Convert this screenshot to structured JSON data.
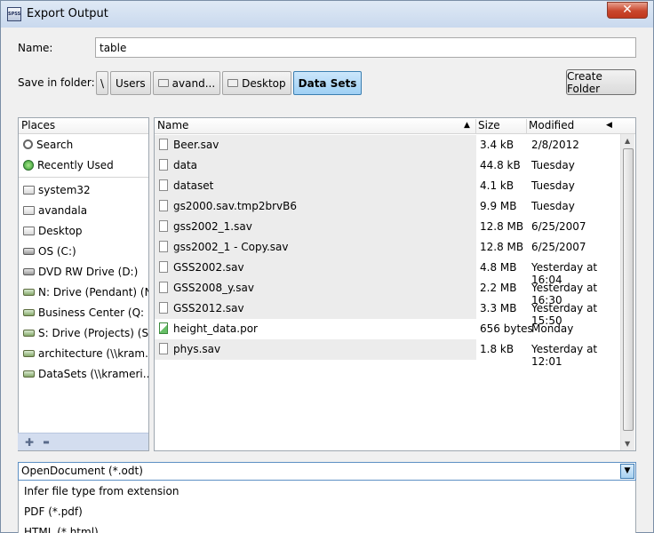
{
  "window": {
    "title": "Export Output",
    "app_icon_text": "SPSS",
    "close_icon": "close-icon"
  },
  "name_field": {
    "label": "Name:",
    "value": "table"
  },
  "folder": {
    "label": "Save in folder:",
    "crumbs": [
      "\\",
      "Users",
      "avand...",
      "Desktop",
      "Data Sets"
    ],
    "create_folder_label": "Create Folder"
  },
  "places": {
    "header": "Places",
    "items": [
      {
        "label": "Search",
        "icon": "search-icon"
      },
      {
        "label": "Recently Used",
        "icon": "recent-icon"
      },
      {
        "label": "system32",
        "icon": "folder-icon"
      },
      {
        "label": "avandala",
        "icon": "folder-icon"
      },
      {
        "label": "Desktop",
        "icon": "folder-icon"
      },
      {
        "label": "OS (C:)",
        "icon": "drive-icon"
      },
      {
        "label": "DVD RW Drive (D:)",
        "icon": "drive-icon"
      },
      {
        "label": "N: Drive (Pendant) (N:)",
        "icon": "network-drive-icon"
      },
      {
        "label": "Business Center (Q: ...",
        "icon": "network-drive-icon"
      },
      {
        "label": "S: Drive (Projects) (S:)",
        "icon": "network-drive-icon"
      },
      {
        "label": "architecture (\\\\kram...)",
        "icon": "network-drive-icon"
      },
      {
        "label": "DataSets (\\\\krameri...)",
        "icon": "network-drive-icon"
      }
    ],
    "add_label": "✚",
    "remove_label": "▬"
  },
  "files": {
    "columns": {
      "name": "Name",
      "size": "Size",
      "modified": "Modified"
    },
    "rows": [
      {
        "name": "Beer.sav",
        "size": "3.4 kB",
        "modified": "2/8/2012",
        "icon": "file-icon"
      },
      {
        "name": "data",
        "size": "44.8 kB",
        "modified": "Tuesday",
        "icon": "file-icon"
      },
      {
        "name": "dataset",
        "size": "4.1 kB",
        "modified": "Tuesday",
        "icon": "file-icon"
      },
      {
        "name": "gs2000.sav.tmp2brvB6",
        "size": "9.9 MB",
        "modified": "Tuesday",
        "icon": "file-icon"
      },
      {
        "name": "gss2002_1.sav",
        "size": "12.8 MB",
        "modified": "6/25/2007",
        "icon": "file-icon"
      },
      {
        "name": "gss2002_1 - Copy.sav",
        "size": "12.8 MB",
        "modified": "6/25/2007",
        "icon": "file-icon"
      },
      {
        "name": "GSS2002.sav",
        "size": "4.8 MB",
        "modified": "Yesterday at 16:04",
        "icon": "file-icon"
      },
      {
        "name": "GSS2008_y.sav",
        "size": "2.2 MB",
        "modified": "Yesterday at 16:30",
        "icon": "file-icon"
      },
      {
        "name": "GSS2012.sav",
        "size": "3.3 MB",
        "modified": "Yesterday at 15:50",
        "icon": "file-icon"
      },
      {
        "name": "height_data.por",
        "size": "656 bytes",
        "modified": "Monday",
        "icon": "data-file-icon"
      },
      {
        "name": "phys.sav",
        "size": "1.8 kB",
        "modified": "Yesterday at 12:01",
        "icon": "file-icon"
      }
    ]
  },
  "filetype": {
    "selected": "OpenDocument (*.odt)",
    "options": [
      "Infer file type from extension",
      "PDF (*.pdf)",
      "HTML (*.html)"
    ]
  }
}
